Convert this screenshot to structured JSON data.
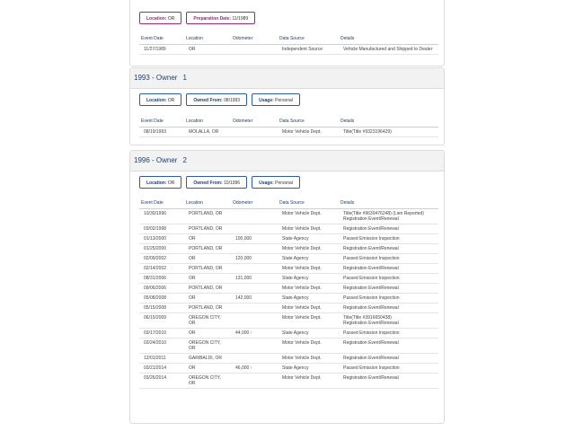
{
  "columns": [
    "Event Date",
    "Location",
    "Odometer",
    "Data Source",
    "Details"
  ],
  "section0": {
    "chips": [
      {
        "label": "Location:",
        "value": "OR"
      },
      {
        "label": "Preparation Date:",
        "value": "11/1989"
      }
    ],
    "rows": [
      {
        "date": "11/27/1989",
        "loc": "OR",
        "odo": "",
        "src": "Independent Source",
        "det": "Vehicle Manufactured and Shipped to Dealer"
      }
    ]
  },
  "section1": {
    "title": "1993 - Owner",
    "num": "1",
    "chips": [
      {
        "label": "Location:",
        "value": "OR"
      },
      {
        "label": "Owned From:",
        "value": "08/1993"
      },
      {
        "label": "Usage:",
        "value": "Personal"
      }
    ],
    "rows": [
      {
        "date": "08/19/1993",
        "loc": "MOLALLA, OR",
        "odo": "",
        "src": "Motor Vehicle Dept.",
        "det": "Title(Title #9323196429)"
      }
    ]
  },
  "section2": {
    "title": "1996 - Owner",
    "num": "2",
    "chips": [
      {
        "label": "Location:",
        "value": "OR"
      },
      {
        "label": "Owned From:",
        "value": "10/1996"
      },
      {
        "label": "Usage:",
        "value": "Personal"
      }
    ],
    "rows": [
      {
        "date": "10/30/1996",
        "loc": "PORTLAND, OR",
        "odo": "",
        "src": "Motor Vehicle Dept.",
        "det": "Title(Title #9630476248) (Lien Reported)\nRegistration Event/Renewal"
      },
      {
        "date": "03/02/1998",
        "loc": "PORTLAND, OR",
        "odo": "",
        "src": "Motor Vehicle Dept.",
        "det": "Registration Event/Renewal"
      },
      {
        "date": "01/13/2000",
        "loc": "OR",
        "odo": "100,000",
        "src": "State Agency",
        "det": "Passed Emission Inspection"
      },
      {
        "date": "01/25/2000",
        "loc": "PORTLAND, OR",
        "odo": "",
        "src": "Motor Vehicle Dept.",
        "det": "Registration Event/Renewal"
      },
      {
        "date": "02/09/2002",
        "loc": "OR",
        "odo": "120,000",
        "src": "State Agency",
        "det": "Passed Emission Inspection"
      },
      {
        "date": "02/14/2002",
        "loc": "PORTLAND, OR",
        "odo": "",
        "src": "Motor Vehicle Dept.",
        "det": "Registration Event/Renewal"
      },
      {
        "date": "08/31/2006",
        "loc": "OR",
        "odo": "131,000",
        "src": "State Agency",
        "det": "Passed Emission Inspection"
      },
      {
        "date": "09/06/2006",
        "loc": "PORTLAND, OR",
        "odo": "",
        "src": "Motor Vehicle Dept.",
        "det": "Registration Event/Renewal"
      },
      {
        "date": "05/08/2008",
        "loc": "OR",
        "odo": "142,000",
        "src": "State Agency",
        "det": "Passed Emission Inspection"
      },
      {
        "date": "05/15/2008",
        "loc": "PORTLAND, OR",
        "odo": "",
        "src": "Motor Vehicle Dept.",
        "det": "Registration Event/Renewal"
      },
      {
        "date": "06/15/2009",
        "loc": "OREGON CITY,\nOR",
        "odo": "",
        "src": "Motor Vehicle Dept.",
        "det": "Title(Title #3916650438)\nRegistration Event/Renewal"
      },
      {
        "date": "03/17/2010",
        "loc": "OR",
        "odo": "44,000 ↑",
        "src": "State Agency",
        "det": "Passed Emission Inspection"
      },
      {
        "date": "03/24/2010",
        "loc": "OREGON CITY,\nOR",
        "odo": "",
        "src": "Motor Vehicle Dept.",
        "det": "Registration Event/Renewal"
      },
      {
        "date": "12/01/2011",
        "loc": "GARIBALDI, OR",
        "odo": "",
        "src": "Motor Vehicle Dept.",
        "det": "Registration Event/Renewal"
      },
      {
        "date": "03/21/2014",
        "loc": "OR",
        "odo": "46,000 ↑",
        "src": "State Agency",
        "det": "Passed Emission Inspection"
      },
      {
        "date": "03/26/2014",
        "loc": "OREGON CITY,\nOR",
        "odo": "",
        "src": "Motor Vehicle Dept.",
        "det": "Registration Event/Renewal"
      }
    ]
  }
}
